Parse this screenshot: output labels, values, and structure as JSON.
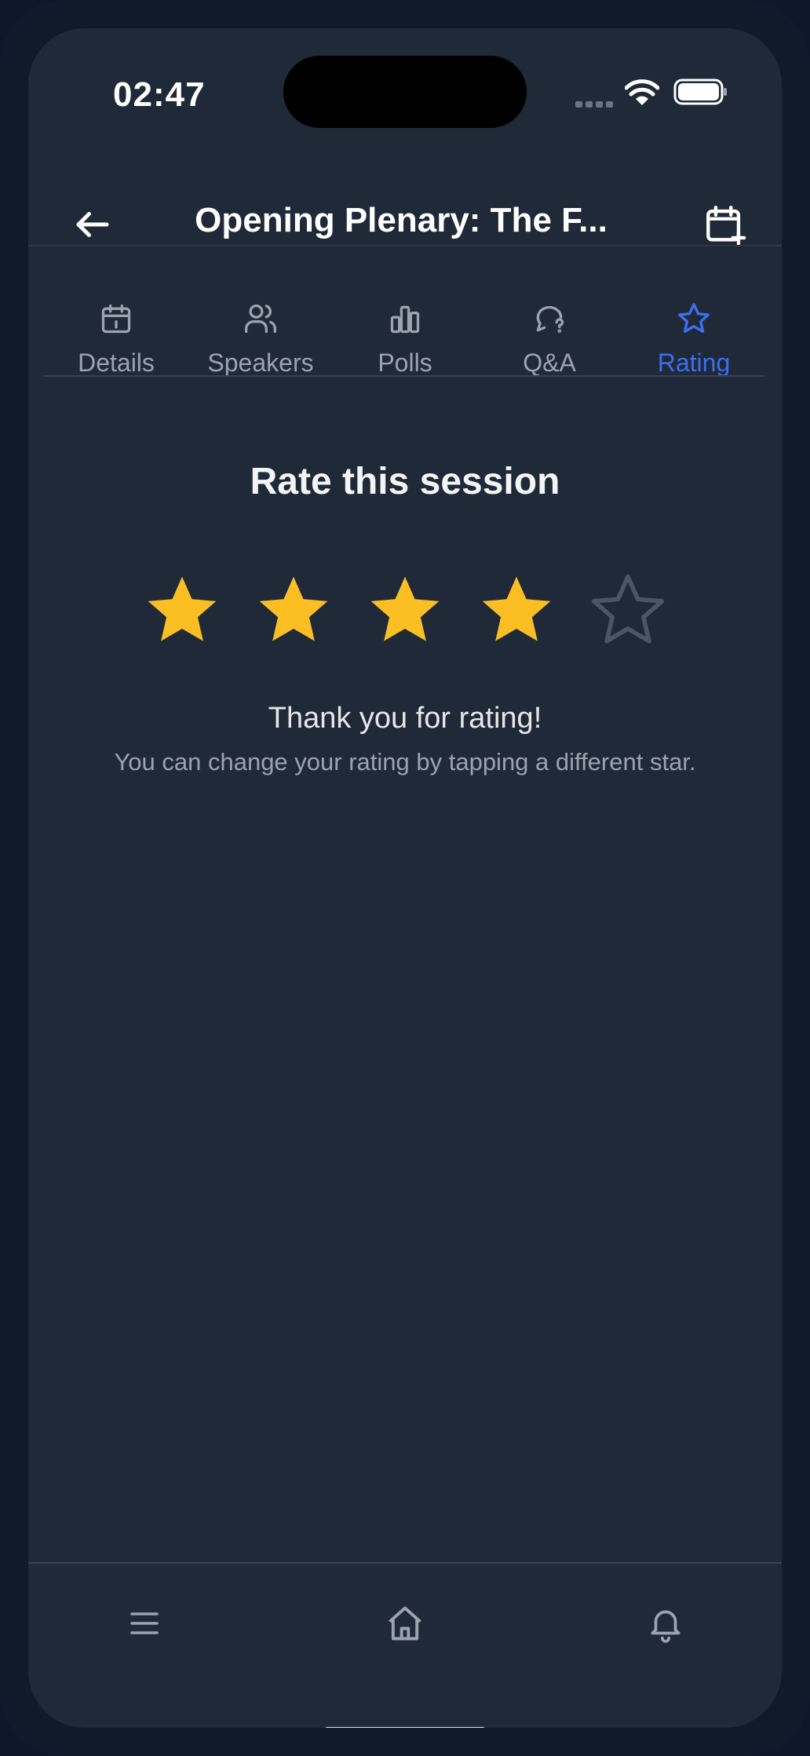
{
  "status_bar": {
    "time": "02:47"
  },
  "header": {
    "title": "Opening Plenary: The F..."
  },
  "tabs": [
    {
      "label": "Details",
      "icon": "calendar-icon"
    },
    {
      "label": "Speakers",
      "icon": "users-icon"
    },
    {
      "label": "Polls",
      "icon": "bar-chart-icon"
    },
    {
      "label": "Q&A",
      "icon": "question-bubble-icon"
    },
    {
      "label": "Rating",
      "icon": "star-icon",
      "active": true
    }
  ],
  "rating": {
    "title": "Rate this session",
    "value": 4,
    "max": 5,
    "thanks": "Thank you for rating!",
    "hint": "You can change your rating by tapping a different star."
  },
  "bottom_nav": [
    {
      "icon": "menu-icon"
    },
    {
      "icon": "home-icon"
    },
    {
      "icon": "bell-icon"
    }
  ],
  "colors": {
    "accent": "#3b6ff0",
    "star_filled": "#fbbf24",
    "star_empty": "#4b5563",
    "background": "#1f2937"
  }
}
